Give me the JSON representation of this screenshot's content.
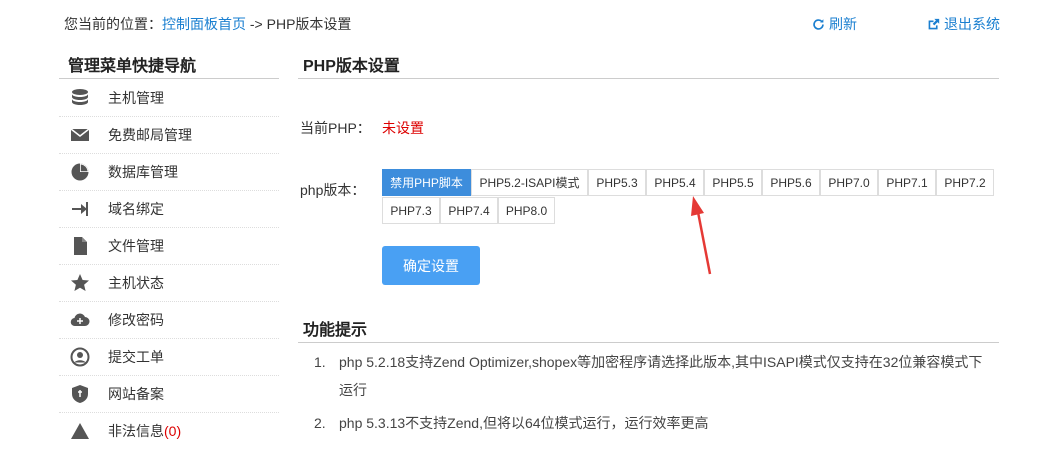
{
  "breadcrumb": {
    "prefix": "您当前的位置：",
    "home_link": "控制面板首页",
    "separator": " -> ",
    "current": "PHP版本设置"
  },
  "top_actions": {
    "refresh": "刷新",
    "logout": "退出系统"
  },
  "sidebar": {
    "title": "管理菜单快捷导航",
    "items": [
      {
        "label": "主机管理",
        "icon": "database-icon"
      },
      {
        "label": "免费邮局管理",
        "icon": "envelope-icon"
      },
      {
        "label": "数据库管理",
        "icon": "pie-chart-icon"
      },
      {
        "label": "域名绑定",
        "icon": "login-arrow-icon"
      },
      {
        "label": "文件管理",
        "icon": "file-icon"
      },
      {
        "label": "主机状态",
        "icon": "star-icon"
      },
      {
        "label": "修改密码",
        "icon": "cloud-icon"
      },
      {
        "label": "提交工单",
        "icon": "user-icon"
      },
      {
        "label": "网站备案",
        "icon": "shield-icon"
      },
      {
        "label": "非法信息",
        "count": "(0)",
        "icon": "warning-icon"
      }
    ]
  },
  "main": {
    "title": "PHP版本设置",
    "current_php_label": "当前PHP：",
    "current_php_value": "未设置",
    "php_version_label": "php版本：",
    "versions": [
      "禁用PHP脚本",
      "PHP5.2-ISAPI模式",
      "PHP5.3",
      "PHP5.4",
      "PHP5.5",
      "PHP5.6",
      "PHP7.0",
      "PHP7.1",
      "PHP7.2",
      "PHP7.3",
      "PHP7.4",
      "PHP8.0"
    ],
    "selected_version": "禁用PHP脚本",
    "confirm_label": "确定设置"
  },
  "tips": {
    "title": "功能提示",
    "items": [
      {
        "num": "1.",
        "text": "php 5.2.18支持Zend Optimizer,shopex等加密程序请选择此版本,其中ISAPI模式仅支持在32位兼容模式下运行"
      },
      {
        "num": "2.",
        "text": "php 5.3.13不支持Zend,但将以64位模式运行，运行效率更高"
      }
    ]
  },
  "colors": {
    "link": "#1a7fd0",
    "accent": "#49a0f3",
    "active_button": "#3d8ddc",
    "warning_text": "#dd0000",
    "annotation_arrow": "#e53935"
  }
}
